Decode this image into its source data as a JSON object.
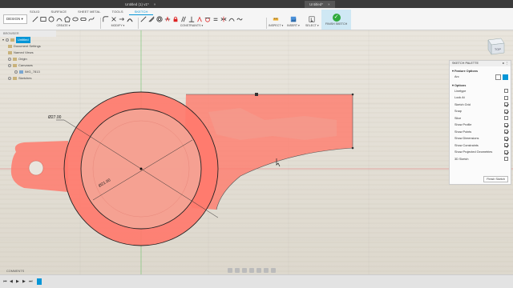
{
  "tabs": {
    "doc1": "Untitled (1) v1*",
    "doc2": "Untitled*"
  },
  "toolbar": {
    "workspace_tabs": [
      "SOLID",
      "SURFACE",
      "SHEET METAL",
      "TOOLS",
      "SKETCH"
    ],
    "design_label": "DESIGN",
    "groups": {
      "create": "CREATE",
      "modify": "MODIFY",
      "constraints": "CONSTRAINTS",
      "inspect": "INSPECT",
      "insert": "INSERT",
      "select": "SELECT",
      "finish": "FINISH SKETCH"
    }
  },
  "browser": {
    "title": "BROWSER",
    "root": "Untitled",
    "items": [
      "Document Settings",
      "Named Views",
      "Origin",
      "Canvases",
      "IMG_7813",
      "Sketches"
    ]
  },
  "dimensions": {
    "outer": "Ø27.00",
    "inner": "Ø21.00"
  },
  "viewcube": {
    "label": "TOP"
  },
  "palette": {
    "title": "SKETCH PALETTE",
    "feature_options": "Feature Options",
    "arc_label": "Arc",
    "options_label": "Options",
    "options": [
      {
        "label": "Linetype",
        "checked": null
      },
      {
        "label": "Look At",
        "checked": null
      },
      {
        "label": "Sketch Grid",
        "checked": true
      },
      {
        "label": "Snap",
        "checked": true
      },
      {
        "label": "Slice",
        "checked": false
      },
      {
        "label": "Show Profile",
        "checked": true
      },
      {
        "label": "Show Points",
        "checked": true
      },
      {
        "label": "Show Dimensions",
        "checked": true
      },
      {
        "label": "Show Constraints",
        "checked": true
      },
      {
        "label": "Show Projected Geometries",
        "checked": true
      },
      {
        "label": "3D Sketch",
        "checked": false
      }
    ],
    "finish_button": "Finish Sketch"
  },
  "comments": {
    "label": "COMMENTS"
  },
  "colors": {
    "accent": "#0696d7",
    "sketch_red": "#ff6f61",
    "finish_green": "#2eaa3c"
  }
}
